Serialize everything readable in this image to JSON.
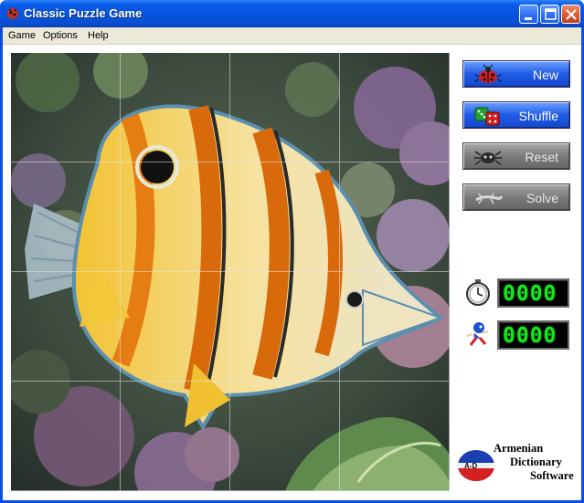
{
  "window": {
    "title": "Classic Puzzle Game"
  },
  "menu": [
    {
      "label": "Game"
    },
    {
      "label": "Options"
    },
    {
      "label": "Help"
    }
  ],
  "board": {
    "grid": "4x4",
    "image_subject": "butterflyfish photo"
  },
  "buttons": {
    "new": {
      "label": "New",
      "icon": "ladybug-icon",
      "enabled": true
    },
    "shuffle": {
      "label": "Shuffle",
      "icon": "dice-icon",
      "enabled": true
    },
    "reset": {
      "label": "Reset",
      "icon": "bug-icon",
      "enabled": false
    },
    "solve": {
      "label": "Solve",
      "icon": "lizard-icon",
      "enabled": false
    }
  },
  "counters": {
    "time": {
      "icon": "stopwatch-icon",
      "value": "0000"
    },
    "moves": {
      "icon": "runner-icon",
      "value": "0000"
    }
  },
  "brand": {
    "logo_letters": "A-D",
    "line1": "Armenian",
    "line2": "Dictionary",
    "line3": "Software"
  },
  "colors": {
    "titlebar": "#0a5ae6",
    "button_active": "#1f5be6",
    "button_disabled": "#7b7b7b",
    "lcd_digits": "#16e81c"
  }
}
